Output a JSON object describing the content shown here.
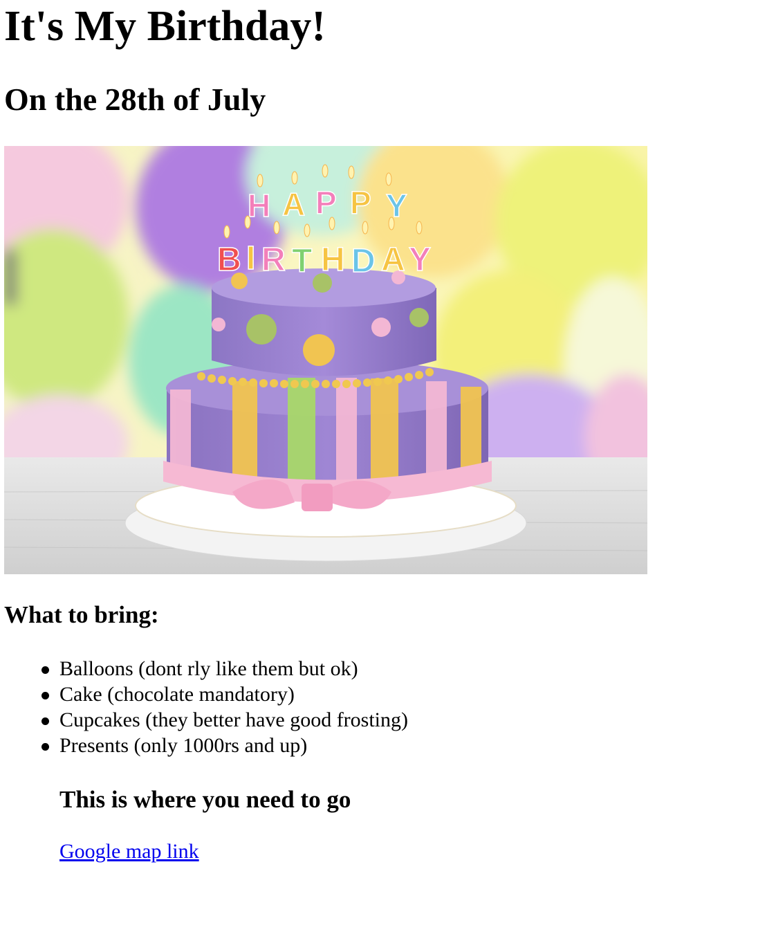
{
  "page": {
    "title": "It's My Birthday!",
    "subtitle": "On the 28th of July"
  },
  "image": {
    "name": "birthday-cake-photo",
    "candle_letters_row1": "HAPPY",
    "candle_letters_row2": "BIRTHDAY"
  },
  "bring": {
    "heading": "What to bring:",
    "items": [
      "Balloons (dont rly like them but ok)",
      "Cake (chocolate mandatory)",
      "Cupcakes (they better have good frosting)",
      "Presents (only 1000rs and up)"
    ]
  },
  "directions": {
    "heading": "This is where you need to go",
    "link_label": "Google map link"
  },
  "colors": {
    "link": "#0000ee",
    "text": "#000000",
    "background": "#ffffff"
  }
}
